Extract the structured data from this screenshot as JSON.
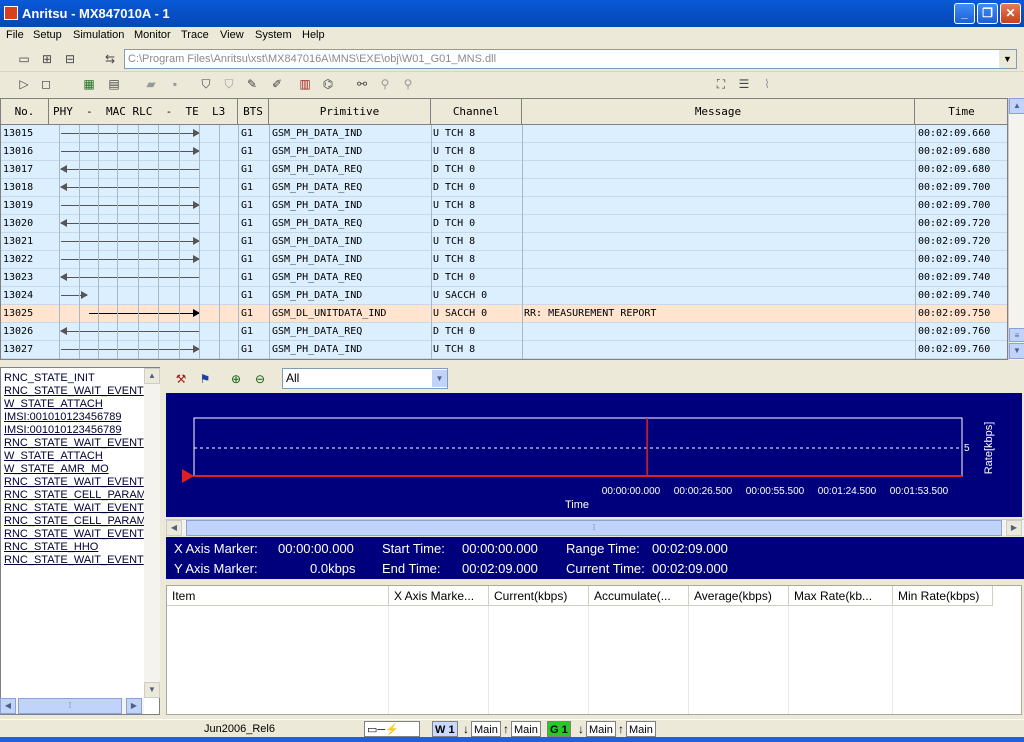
{
  "window": {
    "title": "Anritsu - MX847010A - 1",
    "controls": [
      "minimize",
      "restore",
      "close"
    ]
  },
  "menu": [
    "File",
    "Setup",
    "Simulation",
    "Monitor",
    "Trace",
    "View",
    "System",
    "Help"
  ],
  "toolbar": {
    "path": "C:\\Program Files\\Anritsu\\xst\\MX847016A\\MNS\\EXE\\obj\\W01_G01_MNS.dll"
  },
  "grid": {
    "headers": {
      "no": "No.",
      "layers": "PHY  -  MAC RLC  -  TE  L3",
      "bts": "BTS",
      "primitive": "Primitive",
      "channel": "Channel",
      "message": "Message",
      "time": "Time"
    },
    "rows": [
      {
        "no": "13015",
        "bts": "G1",
        "primitive": "GSM_PH_DATA_IND",
        "channel": "U TCH 8",
        "message": "",
        "time": "00:02:09.660",
        "dir": "r"
      },
      {
        "no": "13016",
        "bts": "G1",
        "primitive": "GSM_PH_DATA_IND",
        "channel": "U TCH 8",
        "message": "",
        "time": "00:02:09.680",
        "dir": "r"
      },
      {
        "no": "13017",
        "bts": "G1",
        "primitive": "GSM_PH_DATA_REQ",
        "channel": "D TCH 0",
        "message": "",
        "time": "00:02:09.680",
        "dir": "l"
      },
      {
        "no": "13018",
        "bts": "G1",
        "primitive": "GSM_PH_DATA_REQ",
        "channel": "D TCH 0",
        "message": "",
        "time": "00:02:09.700",
        "dir": "l"
      },
      {
        "no": "13019",
        "bts": "G1",
        "primitive": "GSM_PH_DATA_IND",
        "channel": "U TCH 8",
        "message": "",
        "time": "00:02:09.700",
        "dir": "r"
      },
      {
        "no": "13020",
        "bts": "G1",
        "primitive": "GSM_PH_DATA_REQ",
        "channel": "D TCH 0",
        "message": "",
        "time": "00:02:09.720",
        "dir": "l"
      },
      {
        "no": "13021",
        "bts": "G1",
        "primitive": "GSM_PH_DATA_IND",
        "channel": "U TCH 8",
        "message": "",
        "time": "00:02:09.720",
        "dir": "r"
      },
      {
        "no": "13022",
        "bts": "G1",
        "primitive": "GSM_PH_DATA_IND",
        "channel": "U TCH 8",
        "message": "",
        "time": "00:02:09.740",
        "dir": "r"
      },
      {
        "no": "13023",
        "bts": "G1",
        "primitive": "GSM_PH_DATA_REQ",
        "channel": "D TCH 0",
        "message": "",
        "time": "00:02:09.740",
        "dir": "l"
      },
      {
        "no": "13024",
        "bts": "G1",
        "primitive": "GSM_PH_DATA_IND",
        "channel": "U SACCH 0",
        "message": "",
        "time": "00:02:09.740",
        "dir": "rs"
      },
      {
        "no": "13025",
        "bts": "G1",
        "primitive": "GSM_DL_UNITDATA_IND",
        "channel": "U SACCH 0",
        "message": "RR: MEASUREMENT REPORT",
        "time": "00:02:09.750",
        "dir": "rb"
      },
      {
        "no": "13026",
        "bts": "G1",
        "primitive": "GSM_PH_DATA_REQ",
        "channel": "D TCH 0",
        "message": "",
        "time": "00:02:09.760",
        "dir": "l"
      },
      {
        "no": "13027",
        "bts": "G1",
        "primitive": "GSM_PH_DATA_IND",
        "channel": "U TCH 8",
        "message": "",
        "time": "00:02:09.760",
        "dir": "r"
      }
    ],
    "selected_row": "13025"
  },
  "states": [
    "RNC_STATE_INIT",
    "RNC_STATE_WAIT_EVENT",
    "W_STATE_ATTACH",
    "IMSI:001010123456789",
    "IMSI:001010123456789",
    "RNC_STATE_WAIT_EVENT",
    "W_STATE_ATTACH",
    "W_STATE_AMR_MO",
    "RNC_STATE_WAIT_EVENT",
    "RNC_STATE_CELL_PARAM",
    "RNC_STATE_WAIT_EVENT",
    "RNC_STATE_CELL_PARAM",
    "RNC_STATE_WAIT_EVENT",
    "RNC_STATE_HHO",
    "RNC_STATE_WAIT_EVENT"
  ],
  "graph": {
    "filter": "All",
    "ylabel": "Rate[kbps]",
    "xlabel": "Time",
    "y_tick": "5",
    "x_ticks": [
      "00:00:00.000",
      "00:00:26.500",
      "00:00:55.500",
      "00:01:24.500",
      "00:01:53.500"
    ],
    "marker_fraction": 0.59
  },
  "info": {
    "x_axis_marker_label": "X Axis Marker:",
    "x_axis_marker": "00:00:00.000",
    "y_axis_marker_label": "Y Axis Marker:",
    "y_axis_marker": "0.0kbps",
    "start_time_label": "Start Time:",
    "start_time": "00:00:00.000",
    "end_time_label": "End Time:",
    "end_time": "00:02:09.000",
    "range_time_label": "Range Time:",
    "range_time": "00:02:09.000",
    "current_time_label": "Current Time:",
    "current_time": "00:02:09.000"
  },
  "stats_table": {
    "headers": [
      "Item",
      "X Axis Marke...",
      "Current(kbps)",
      "Accumulate(...",
      "Average(kbps)",
      "Max Rate(kb...",
      "Min Rate(kbps)"
    ]
  },
  "status": {
    "version": "Jun2006_Rel6",
    "w_label": "W 1",
    "g_label": "G 1",
    "main": "Main"
  },
  "colors": {
    "title_bar": "#0a5ad8",
    "row_bg": "#dcefff",
    "selected_row_bg": "#ffe4cf",
    "graph_bg": "#00007c",
    "marker": "#e02020",
    "g_badge": "#22cc22"
  }
}
